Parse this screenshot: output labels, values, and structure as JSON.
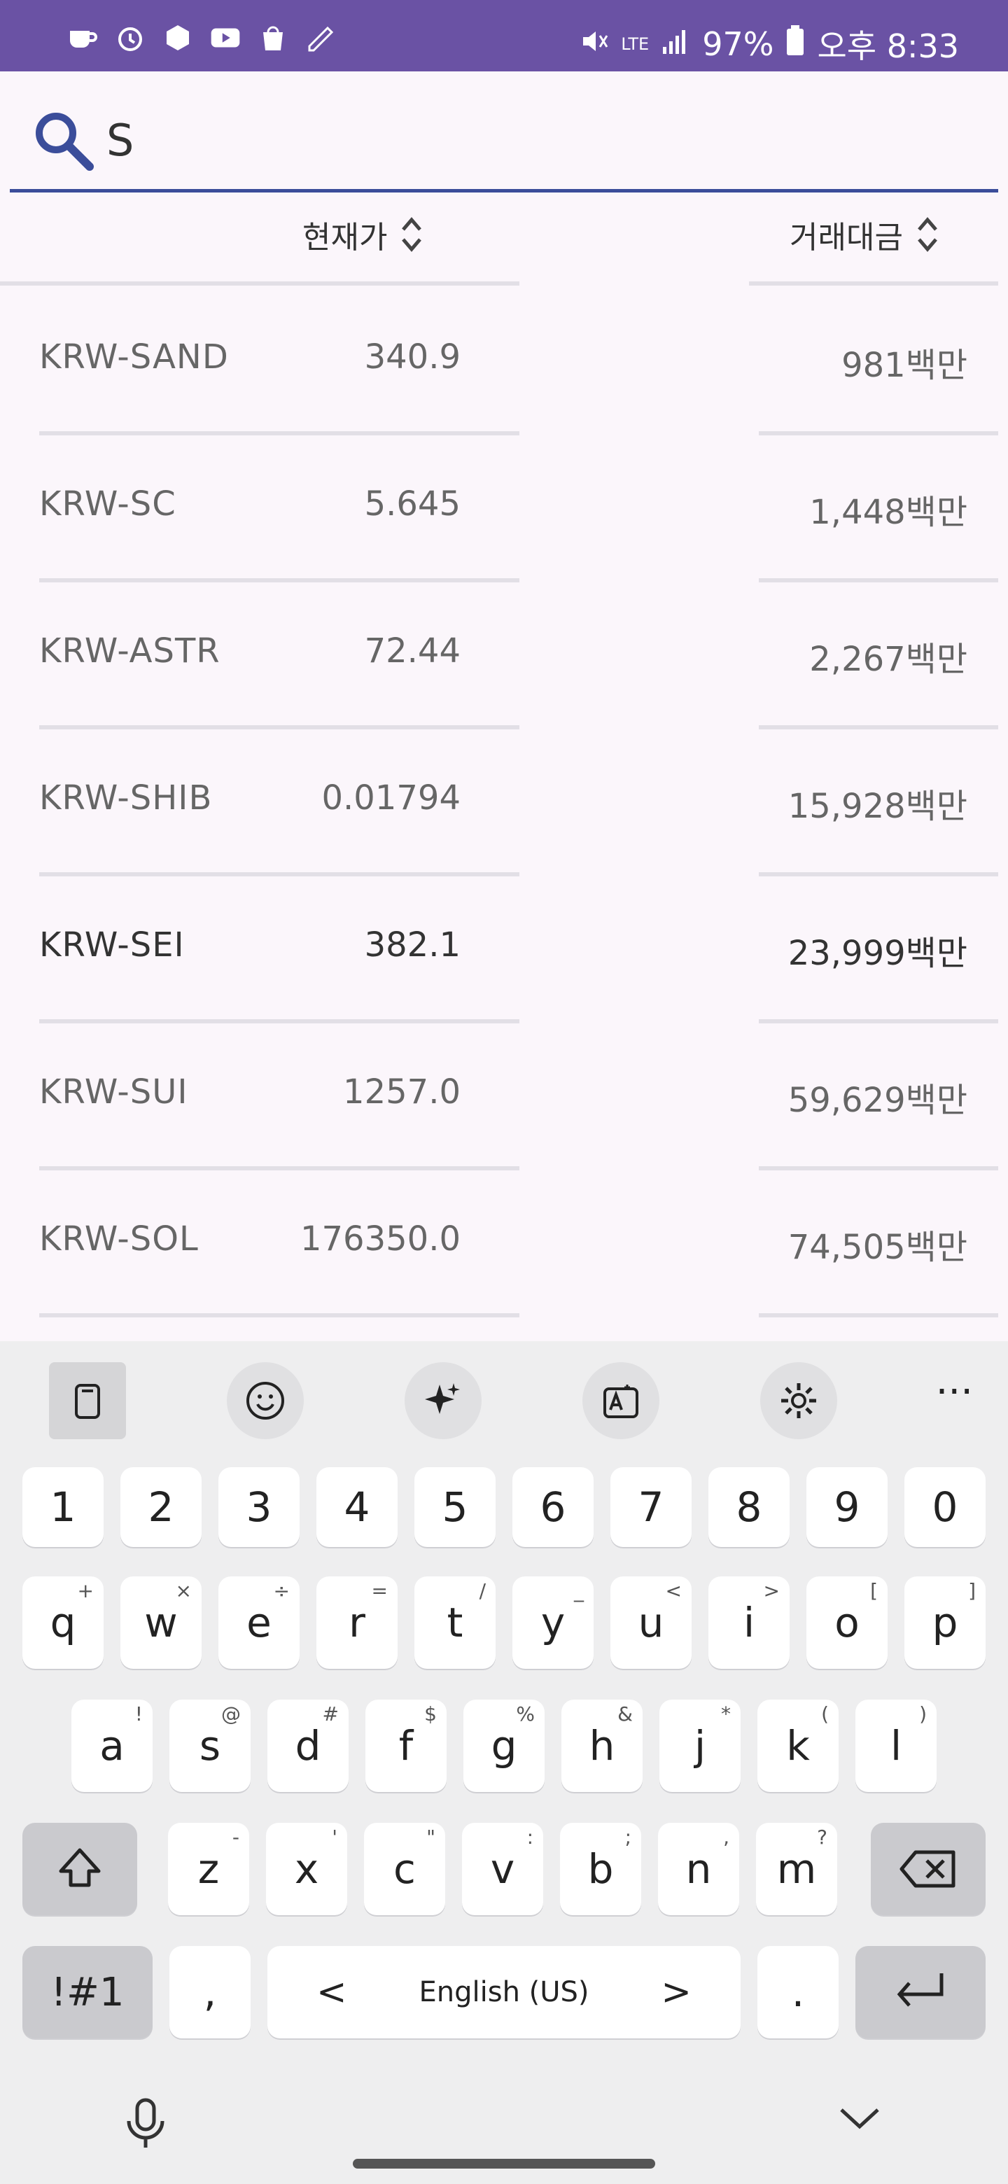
{
  "status_bar": {
    "battery": "97%",
    "time": "오후 8:33",
    "network": "LTE"
  },
  "search": {
    "value": "S"
  },
  "table": {
    "headers": [
      "현재가",
      "거래대금"
    ],
    "rows": [
      {
        "market": "KRW-SAND",
        "price": "340.9",
        "volume": "981백만"
      },
      {
        "market": "KRW-SC",
        "price": "5.645",
        "volume": "1,448백만"
      },
      {
        "market": "KRW-ASTR",
        "price": "72.44",
        "volume": "2,267백만"
      },
      {
        "market": "KRW-SHIB",
        "price": "0.01794",
        "volume": "15,928백만"
      },
      {
        "market": "KRW-SEI",
        "price": "382.1",
        "volume": "23,999백만"
      },
      {
        "market": "KRW-SUI",
        "price": "1257.0",
        "volume": "59,629백만"
      },
      {
        "market": "KRW-SOL",
        "price": "176350.0",
        "volume": "74,505백만"
      }
    ]
  },
  "keyboard": {
    "toolbar": {
      "more": "···"
    },
    "row_numbers": [
      "1",
      "2",
      "3",
      "4",
      "5",
      "6",
      "7",
      "8",
      "9",
      "0"
    ],
    "row_q": [
      {
        "k": "q",
        "s": "+"
      },
      {
        "k": "w",
        "s": "×"
      },
      {
        "k": "e",
        "s": "÷"
      },
      {
        "k": "r",
        "s": "="
      },
      {
        "k": "t",
        "s": "/"
      },
      {
        "k": "y",
        "s": "_"
      },
      {
        "k": "u",
        "s": "<"
      },
      {
        "k": "i",
        "s": ">"
      },
      {
        "k": "o",
        "s": "["
      },
      {
        "k": "p",
        "s": "]"
      }
    ],
    "row_a": [
      {
        "k": "a",
        "s": "!"
      },
      {
        "k": "s",
        "s": "@"
      },
      {
        "k": "d",
        "s": "#"
      },
      {
        "k": "f",
        "s": "$"
      },
      {
        "k": "g",
        "s": "%"
      },
      {
        "k": "h",
        "s": "&"
      },
      {
        "k": "j",
        "s": "*"
      },
      {
        "k": "k",
        "s": "("
      },
      {
        "k": "l",
        "s": ")"
      }
    ],
    "row_z": [
      {
        "k": "z",
        "s": "-"
      },
      {
        "k": "x",
        "s": "'"
      },
      {
        "k": "c",
        "s": "\""
      },
      {
        "k": "v",
        "s": ":"
      },
      {
        "k": "b",
        "s": ";"
      },
      {
        "k": "n",
        "s": ","
      },
      {
        "k": "m",
        "s": "?"
      }
    ],
    "symbols_label": "!#1",
    "comma": ",",
    "space_label": "English (US)",
    "space_left": "<",
    "space_right": ">",
    "period": "."
  }
}
